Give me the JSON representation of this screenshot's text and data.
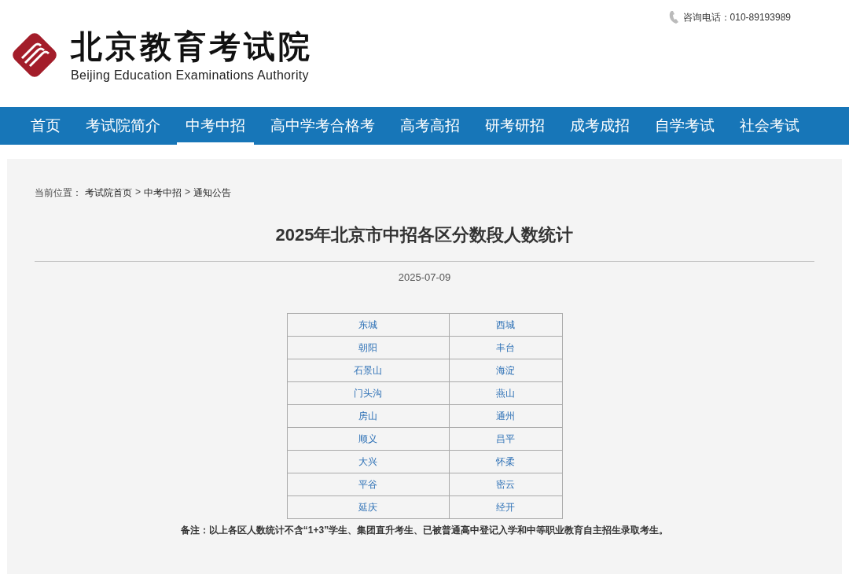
{
  "header": {
    "logo_title": "北京教育考试院",
    "logo_subtitle": "Beijing Education Examinations Authority",
    "hotline": "咨询电话：010-89193989"
  },
  "nav": [
    {
      "label": "首页",
      "selected": false
    },
    {
      "label": "考试院简介",
      "selected": false
    },
    {
      "label": "中考中招",
      "selected": true
    },
    {
      "label": "高中学考合格考",
      "selected": false
    },
    {
      "label": "高考高招",
      "selected": false
    },
    {
      "label": "研考研招",
      "selected": false
    },
    {
      "label": "成考成招",
      "selected": false
    },
    {
      "label": "自学考试",
      "selected": false
    },
    {
      "label": "社会考试",
      "selected": false
    }
  ],
  "breadcrumb": [
    {
      "kind": "text",
      "text": "当前位置："
    },
    {
      "kind": "link",
      "text": "考试院首页"
    },
    {
      "kind": "text",
      "text": ">"
    },
    {
      "kind": "link",
      "text": "中考中招"
    },
    {
      "kind": "text",
      "text": ">"
    },
    {
      "kind": "link",
      "text": "通知公告"
    }
  ],
  "article": {
    "title": "2025年北京市中招各区分数段人数统计",
    "date": "2025-07-09",
    "table": {
      "rows": [
        [
          "东城",
          "西城"
        ],
        [
          "朝阳",
          "丰台"
        ],
        [
          "石景山",
          "海淀"
        ],
        [
          "门头沟",
          "燕山"
        ],
        [
          "房山",
          "通州"
        ],
        [
          "顺义",
          "昌平"
        ],
        [
          "大兴",
          "怀柔"
        ],
        [
          "平谷",
          "密云"
        ],
        [
          "延庆",
          "经开"
        ]
      ]
    },
    "note": "备注：以上各区人数统计不含“1+3”学生、集团直升考生、已被普通高中登记入学和中等职业教育自主招生录取考生。"
  }
}
